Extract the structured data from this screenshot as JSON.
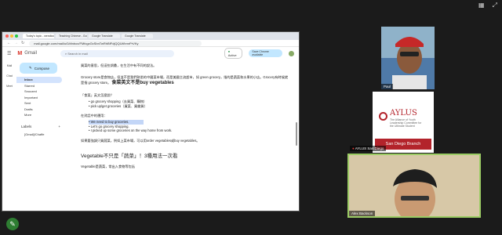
{
  "browser": {
    "tabs": [
      "Today's topic - wendiochem",
      "Teaching Chinese - Google Docs",
      "Google Translate",
      "Google Translate"
    ],
    "url": "mail.google.com/mail/u/0/#inbox/FMfcgzGxSbnTwRhBfFdjQQLWhmrPrVKy"
  },
  "gmail": {
    "brand": "Gmail",
    "search_placeholder": "Search in mail",
    "status": "Active",
    "enable_prompt": "Save Chrome available",
    "rail": [
      "Mail",
      "Chat",
      "Meet"
    ],
    "compose": "Compose",
    "folders": [
      "Inbox",
      "Starred",
      "Snoozed",
      "Important",
      "Sent",
      "Drafts",
      "More"
    ],
    "labels_title": "Labels",
    "labels": [
      "[Gmail]/Chaffe"
    ]
  },
  "email": {
    "line0": "買菜的意思，但這些詞彙，在生活中有不同的說法。",
    "para1": "Grocery store是食物店，但並不是我們熟悉的中國菜市場，而是美國主流超市，如 green grocery，指的是蔬菜和水果的小店。Grocery有時候就是指 grocery store。",
    "para1_big": "食菜英文不是buy vegetables",
    "q1": "「食菜」英文怎麼說？",
    "bullets1": [
      "• go grocery shopping（去買菜、購物）",
      "• pick up/get groceries（買菜、買雜貨）"
    ],
    "example_hdr": "在對話中的運用：",
    "bullets2": [
      "• We need to buy groceries.",
      "• Let's go grocery shopping.",
      "• I picked up some groceries on the way home from work."
    ],
    "note": "如果要強調只買蔬菜，例如上菜市場，可以用order vegetables或buy vegetables。",
    "heading2": "Vegetable不只是「蔬菜」！3種用法一次看",
    "last": "Vegetable是蔬菜，常出入食物等包括"
  },
  "participants": [
    {
      "name": "Paul"
    },
    {
      "name": "AYLUS San Diego",
      "logo_title": "AYLUS",
      "logo_sub": "The Alliance of Youth Leadership Committee for the Ultimate Student",
      "logo_banner": "San Diego Branch"
    },
    {
      "name": "Alex Backson"
    }
  ],
  "colors": {
    "accent": "#b3232b",
    "compose": "#c2e7ff",
    "background": "#1b1b1b"
  }
}
